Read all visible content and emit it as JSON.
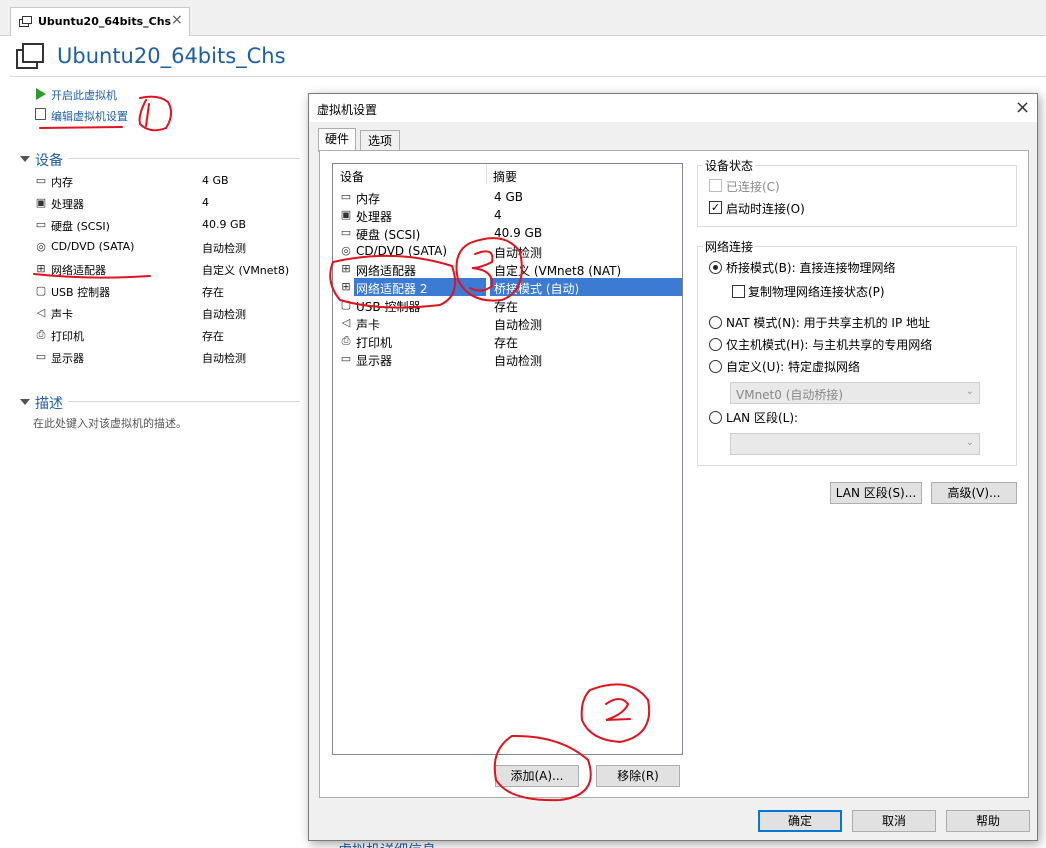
{
  "tab": {
    "title": "Ubuntu20_64bits_Chs",
    "close": "×"
  },
  "header": {
    "title": "Ubuntu20_64bits_Chs"
  },
  "actions": {
    "power_on": "开启此虚拟机",
    "edit_settings": "编辑虚拟机设置"
  },
  "devices_section": {
    "title": "设备",
    "items": [
      {
        "name": "内存",
        "value": "4 GB",
        "icon": "memory-icon"
      },
      {
        "name": "处理器",
        "value": "4",
        "icon": "cpu-icon"
      },
      {
        "name": "硬盘 (SCSI)",
        "value": "40.9 GB",
        "icon": "hdd-icon"
      },
      {
        "name": "CD/DVD (SATA)",
        "value": "自动检测",
        "icon": "cd-icon"
      },
      {
        "name": "网络适配器",
        "value": "自定义 (VMnet8)",
        "icon": "network-icon"
      },
      {
        "name": "USB 控制器",
        "value": "存在",
        "icon": "usb-icon"
      },
      {
        "name": "声卡",
        "value": "自动检测",
        "icon": "sound-icon"
      },
      {
        "name": "打印机",
        "value": "存在",
        "icon": "printer-icon"
      },
      {
        "name": "显示器",
        "value": "自动检测",
        "icon": "display-icon"
      }
    ]
  },
  "description_section": {
    "title": "描述",
    "placeholder": "在此处键入对该虚拟机的描述。"
  },
  "bottom_partial": "虚拟机详细信息",
  "dialog": {
    "title": "虚拟机设置",
    "close": "×",
    "tabs": [
      "硬件",
      "选项"
    ],
    "list": {
      "col_device": "设备",
      "col_summary": "摘要",
      "rows": [
        {
          "name": "内存",
          "value": "4 GB",
          "icon": "memory-icon"
        },
        {
          "name": "处理器",
          "value": "4",
          "icon": "cpu-icon"
        },
        {
          "name": "硬盘 (SCSI)",
          "value": "40.9 GB",
          "icon": "hdd-icon"
        },
        {
          "name": "CD/DVD (SATA)",
          "value": "自动检测",
          "icon": "cd-icon"
        },
        {
          "name": "网络适配器",
          "value": "自定义 (VMnet8 (NAT)",
          "icon": "network-icon"
        },
        {
          "name": "网络适配器 2",
          "value": "桥接模式 (自动)",
          "icon": "network-icon",
          "selected": true
        },
        {
          "name": "USB 控制器",
          "value": "存在",
          "icon": "usb-icon"
        },
        {
          "name": "声卡",
          "value": "自动检测",
          "icon": "sound-icon"
        },
        {
          "name": "打印机",
          "value": "存在",
          "icon": "printer-icon"
        },
        {
          "name": "显示器",
          "value": "自动检测",
          "icon": "display-icon"
        }
      ]
    },
    "add_button": "添加(A)...",
    "remove_button": "移除(R)",
    "device_status": {
      "title": "设备状态",
      "connected": "已连接(C)",
      "connected_checked": false,
      "connect_on_power": "启动时连接(O)",
      "connect_on_power_checked": true
    },
    "network": {
      "title": "网络连接",
      "bridged": "桥接模式(B): 直接连接物理网络",
      "replicate": "复制物理网络连接状态(P)",
      "nat": "NAT 模式(N): 用于共享主机的 IP 地址",
      "host_only": "仅主机模式(H): 与主机共享的专用网络",
      "custom": "自定义(U): 特定虚拟网络",
      "custom_value": "VMnet0 (自动桥接)",
      "lan_segment": "LAN 区段(L):",
      "lan_value": "",
      "selected": "bridged"
    },
    "lan_segments_button": "LAN 区段(S)...",
    "advanced_button": "高级(V)...",
    "ok_button": "确定",
    "cancel_button": "取消",
    "help_button": "帮助"
  },
  "annotations": [
    "1",
    "2",
    "3"
  ],
  "colors": {
    "link": "#1e5ea8",
    "selection": "#3b7bd4",
    "annotation": "#e0141e"
  }
}
